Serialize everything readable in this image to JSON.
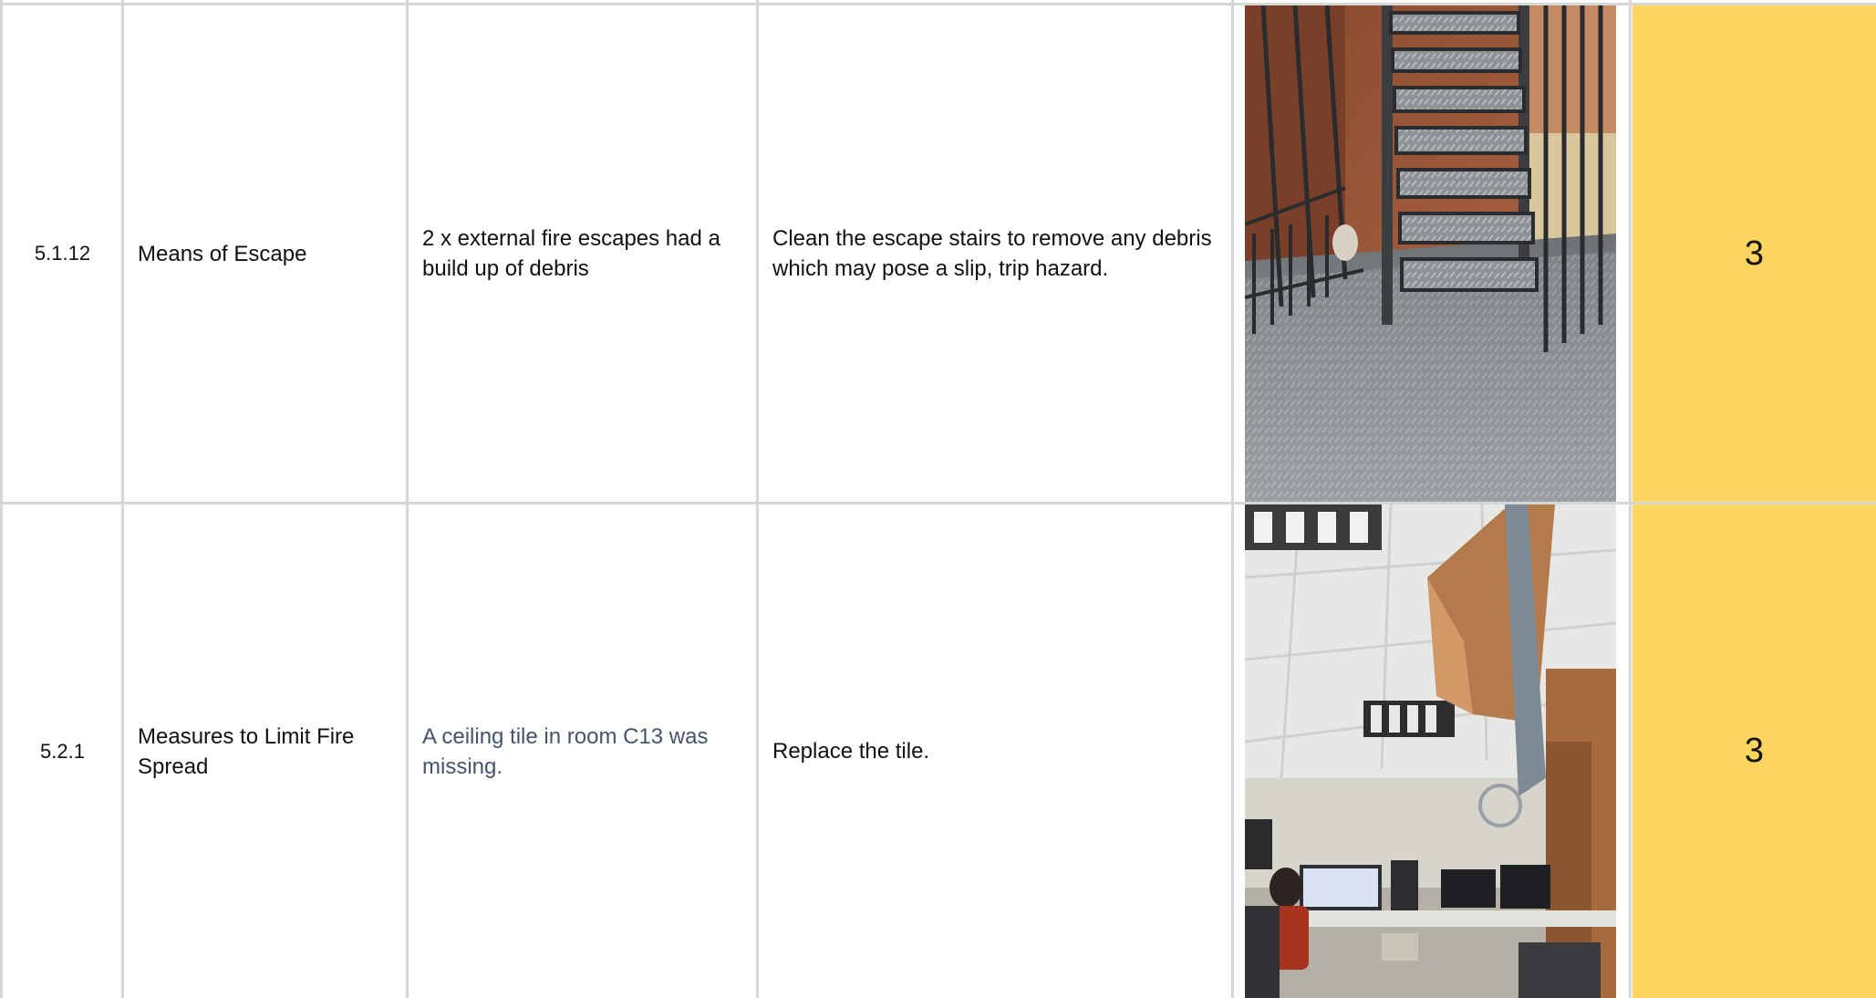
{
  "rows": [
    {
      "ref": "5.1.12",
      "section": "Means of Escape",
      "finding": "2 x external fire escapes had a build up of debris",
      "action": "Clean the escape stairs to remove any debris which may pose a slip, trip hazard.",
      "photo_icon": "external-fire-escape-stairs-photo",
      "priority": "3"
    },
    {
      "ref": "5.2.1",
      "section": "Measures to Limit Fire Spread",
      "finding": "A ceiling tile in room C13 was missing.",
      "action": "Replace the tile.",
      "photo_icon": "office-missing-ceiling-tile-photo",
      "priority": "3"
    }
  ],
  "colors": {
    "priority_fill": "#fdd55f",
    "grid_line": "#d6d6d6",
    "muted_text": "#44546a"
  }
}
